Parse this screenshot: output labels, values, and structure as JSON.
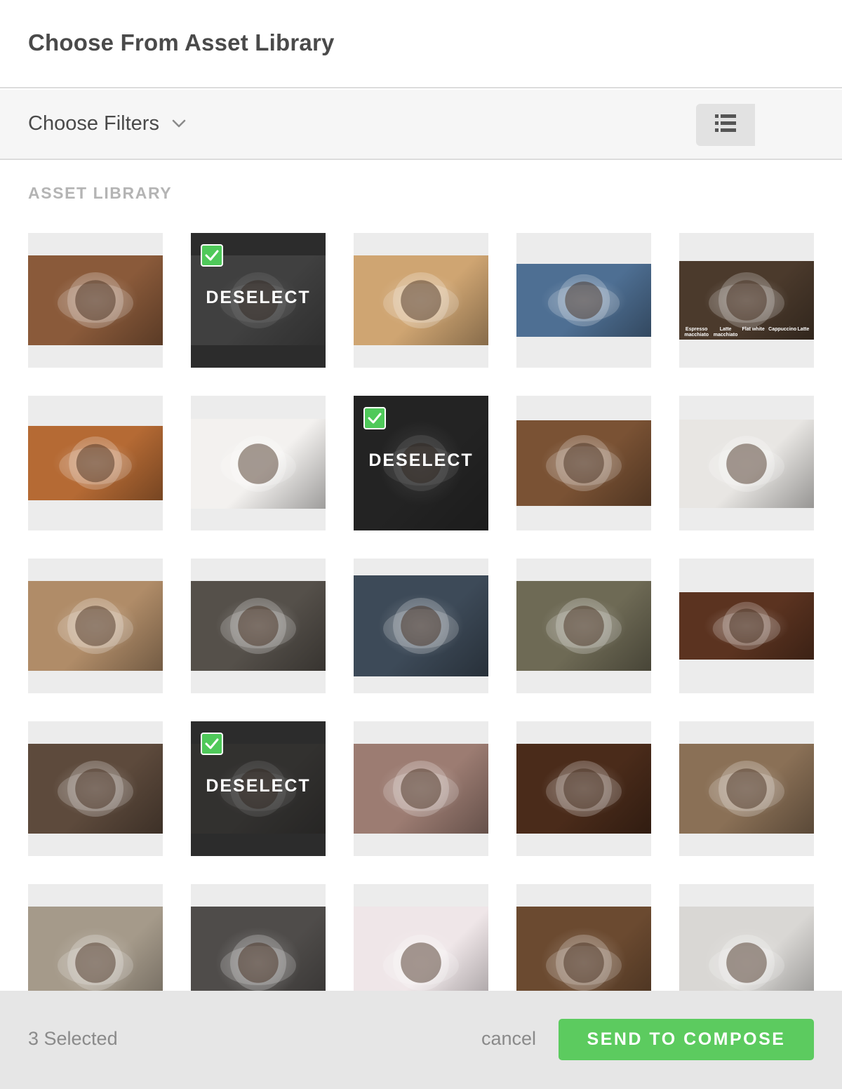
{
  "header": {
    "title": "Choose From Asset Library"
  },
  "filters": {
    "label": "Choose Filters"
  },
  "view_toggle": {
    "options": [
      "list-view",
      "grid-view"
    ],
    "active": "grid-view"
  },
  "section": {
    "title": "ASSET LIBRARY"
  },
  "assets": [
    {
      "name": "cappuccino-coffee-beans",
      "selected": false,
      "thumb": "#8a5a3a"
    },
    {
      "name": "coffee-cup-dark",
      "selected": true,
      "thumb": "#6a6a6a"
    },
    {
      "name": "latte-art-caramel",
      "selected": false,
      "thumb": "#cfa572"
    },
    {
      "name": "cookie-monster-office",
      "selected": false,
      "thumb": "#4e6f93"
    },
    {
      "name": "coffee-drink-types",
      "selected": false,
      "thumb": "#4b3a2c",
      "caption_labels": [
        "Espresso macchiato",
        "Latte macchiato",
        "Flat white",
        "Cappuccino",
        "Latte"
      ]
    },
    {
      "name": "hot-chocolate-mug",
      "selected": false,
      "thumb": "#b56a34"
    },
    {
      "name": "spoon-heart-cup",
      "selected": false,
      "thumb": "#f3f1ef"
    },
    {
      "name": "black-mugs",
      "selected": true,
      "thumb": "#2b2b2b"
    },
    {
      "name": "latte-art-wood-table",
      "selected": false,
      "thumb": "#7a5234"
    },
    {
      "name": "hand-black-coffee",
      "selected": false,
      "thumb": "#e8e6e3"
    },
    {
      "name": "mug-and-pastry",
      "selected": false,
      "thumb": "#b08c68"
    },
    {
      "name": "espresso-machine-pour",
      "selected": false,
      "thumb": "#55504a"
    },
    {
      "name": "moka-pot-coffee-mug",
      "selected": false,
      "thumb": "#3d4a58"
    },
    {
      "name": "glasses-coffee-cookies",
      "selected": false,
      "thumb": "#6e6a55"
    },
    {
      "name": "roasted-beans-closeup",
      "selected": false,
      "thumb": "#5b3320"
    },
    {
      "name": "stirring-coffee-cup",
      "selected": false,
      "thumb": "#5d4a3c"
    },
    {
      "name": "hands-coffee-cafe",
      "selected": true,
      "thumb": "#4d4a46"
    },
    {
      "name": "woman-coffee-sweater",
      "selected": false,
      "thumb": "#9c7c72"
    },
    {
      "name": "espresso-on-beans",
      "selected": false,
      "thumb": "#4a2b1a"
    },
    {
      "name": "portafilter-ground-coffee",
      "selected": false,
      "thumb": "#8a7056"
    },
    {
      "name": "latte-glass-table",
      "selected": false,
      "thumb": "#a59a8a"
    },
    {
      "name": "laptop-notes-coffee",
      "selected": false,
      "thumb": "#4f4c4a"
    },
    {
      "name": "heart-mug-snow",
      "selected": false,
      "thumb": "#efe6e8"
    },
    {
      "name": "laptop-wooden-desk",
      "selected": false,
      "thumb": "#6b4a30"
    },
    {
      "name": "smiley-coffee-foam",
      "selected": false,
      "thumb": "#d9d7d4"
    }
  ],
  "tile_overlay": {
    "deselect_label": "DESELECT"
  },
  "footer": {
    "selected_count": "3 Selected",
    "cancel_label": "cancel",
    "send_label": "SEND TO COMPOSE"
  },
  "colors": {
    "accent_green": "#5ccb5f",
    "check_green": "#4fc95a",
    "toggle_active": "#7d7d7d"
  }
}
